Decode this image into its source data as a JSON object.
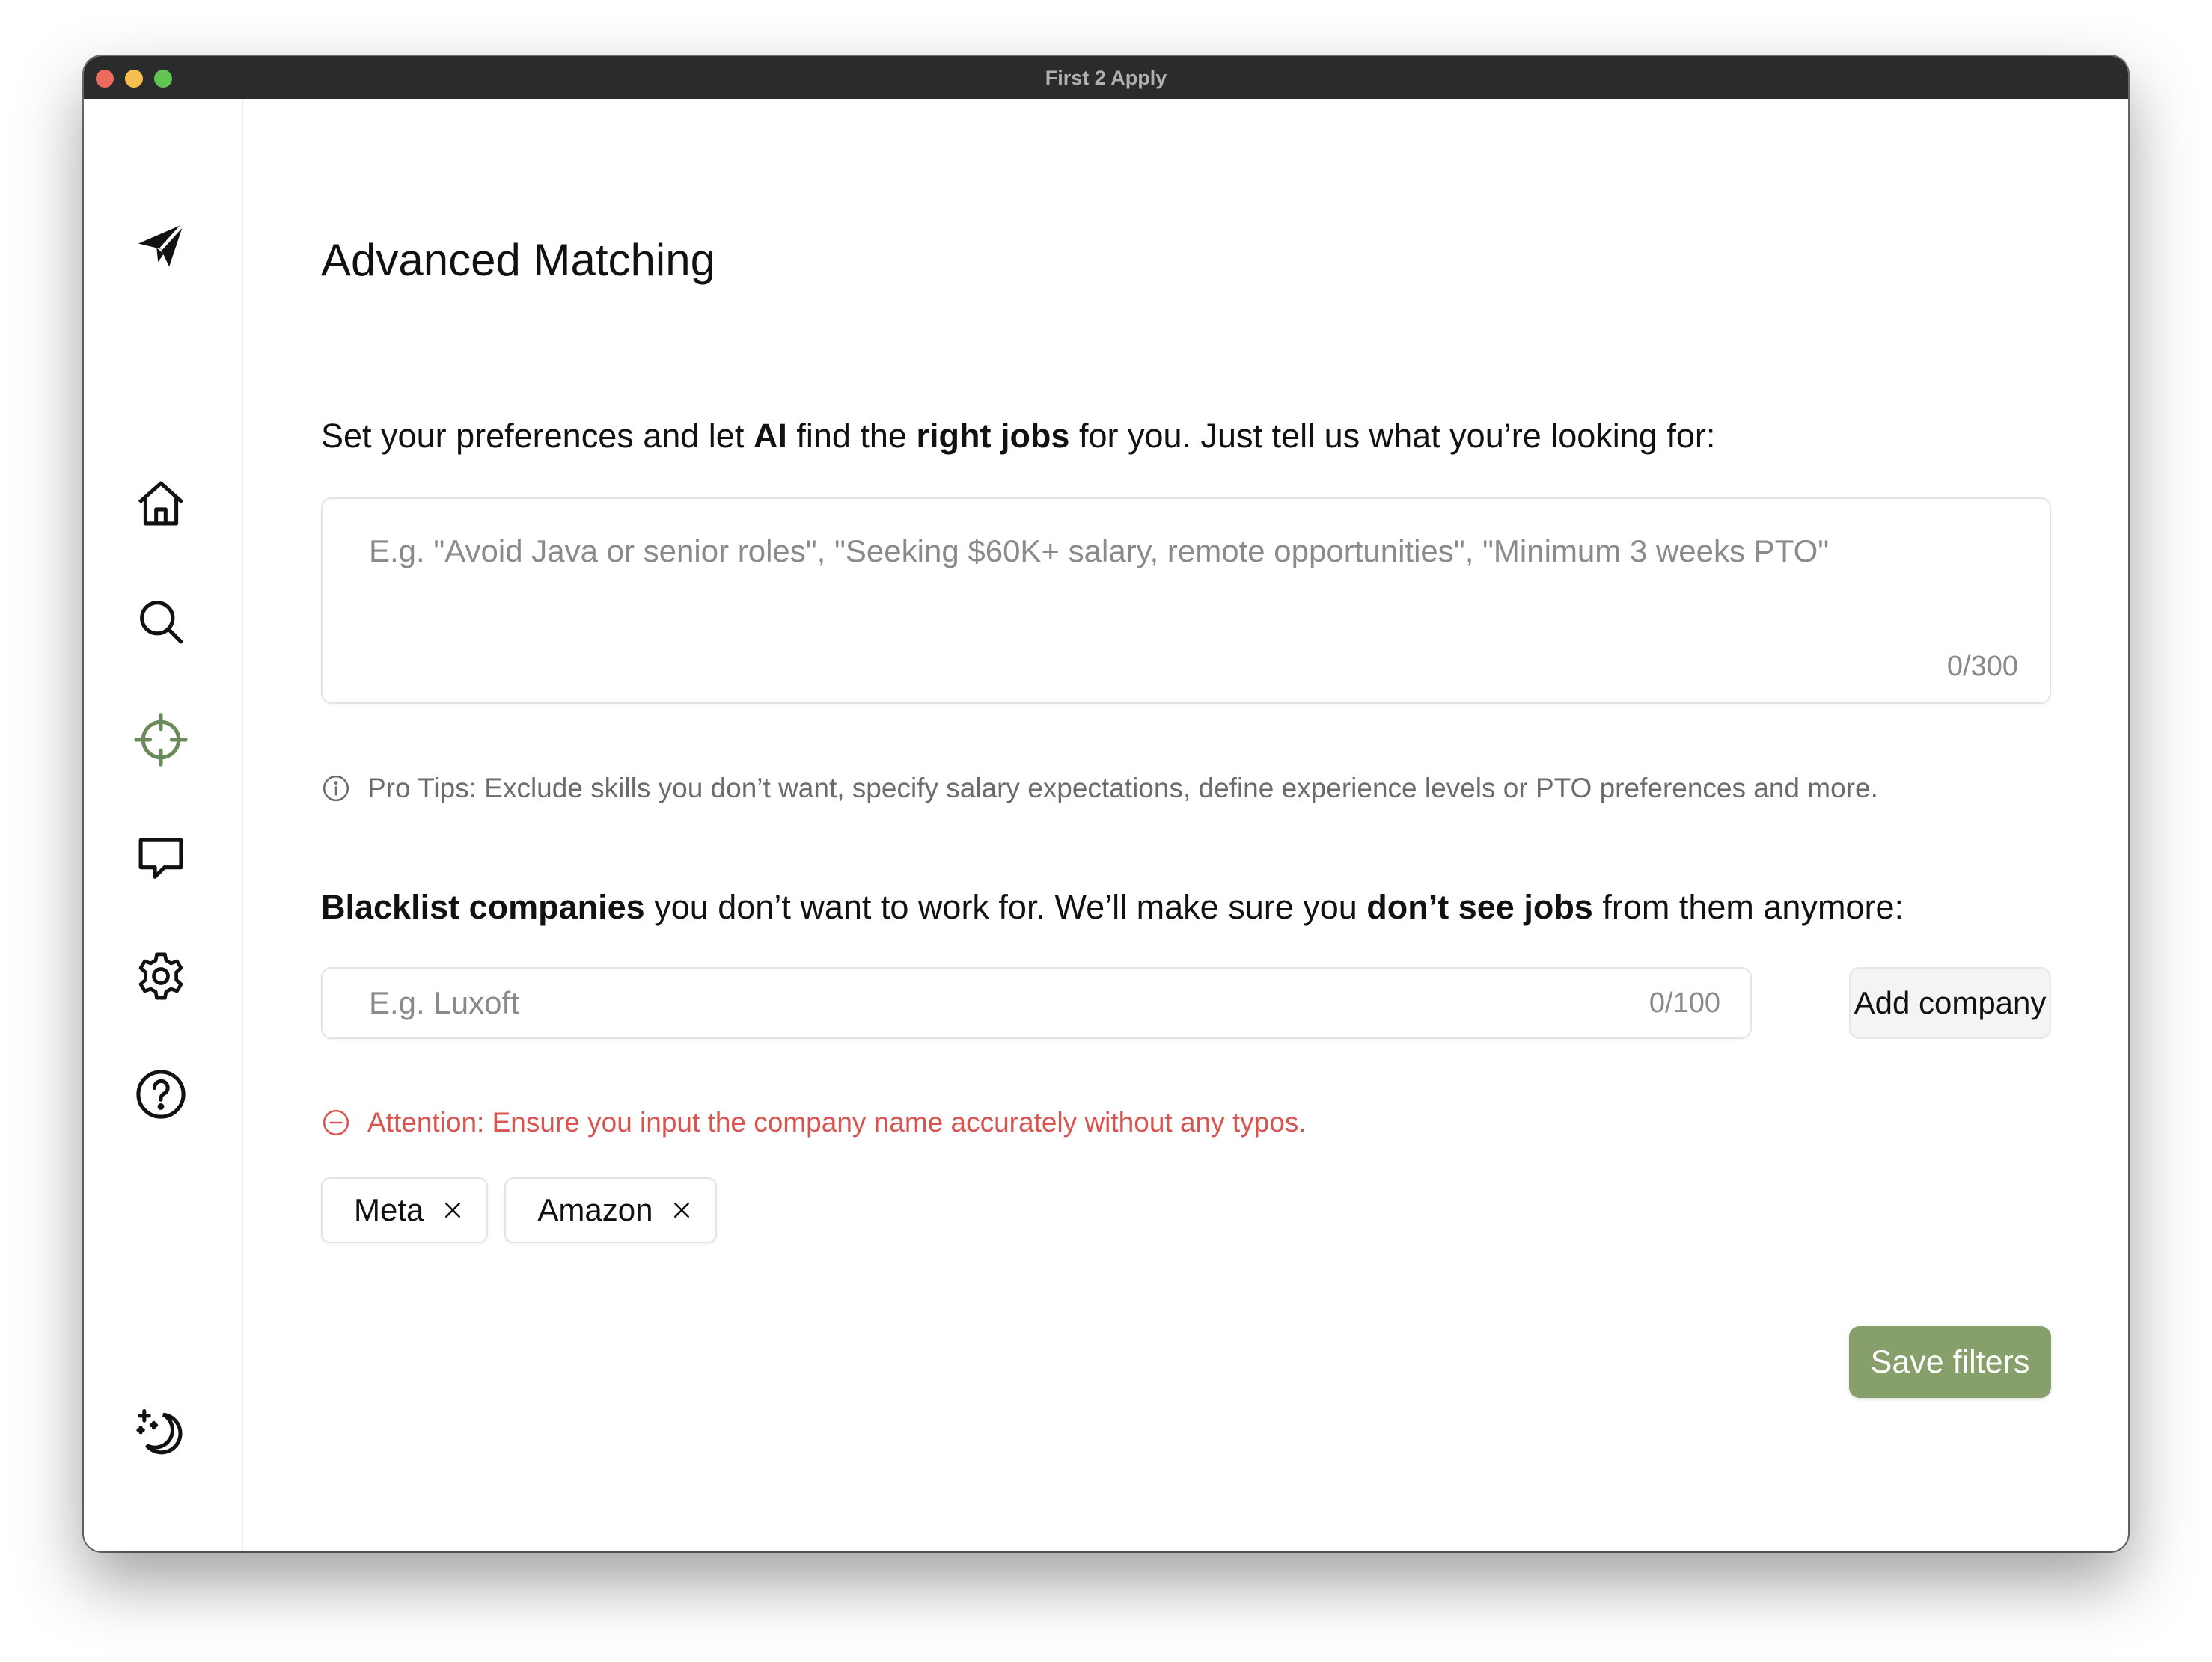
{
  "window": {
    "title": "First 2 Apply"
  },
  "sidebar": {
    "items": [
      {
        "icon": "paper-plane-icon",
        "label": ""
      },
      {
        "icon": "home-icon",
        "label": ""
      },
      {
        "icon": "search-icon",
        "label": ""
      },
      {
        "icon": "crosshair-icon",
        "label": "",
        "active": true
      },
      {
        "icon": "chat-bubble-icon",
        "label": ""
      },
      {
        "icon": "gear-icon",
        "label": ""
      },
      {
        "icon": "help-icon",
        "label": ""
      },
      {
        "icon": "moon-stars-icon",
        "label": ""
      }
    ],
    "active_color": "#6b8a5a"
  },
  "main": {
    "title": "Advanced Matching",
    "preferences": {
      "heading_parts": [
        "Set your preferences and let ",
        "AI",
        " find the ",
        "right jobs",
        " for you. Just tell us what you’re looking for:"
      ],
      "placeholder": "E.g. \"Avoid Java or senior roles\", \"Seeking $60K+ salary, remote opportunities\", \"Minimum 3 weeks PTO\"",
      "value": "",
      "counter": "0/300",
      "tip": "Pro Tips: Exclude skills you don’t want, specify salary expectations, define experience levels or PTO preferences and more."
    },
    "blacklist": {
      "heading_parts": [
        "Blacklist companies",
        " you don’t want to work for. We’ll make sure you ",
        "don’t see jobs",
        " from them anymore:"
      ],
      "placeholder": "E.g. Luxoft",
      "value": "",
      "counter": "0/100",
      "add_button": "Add company",
      "attention": "Attention: Ensure you input the company name accurately without any typos.",
      "companies": [
        "Meta",
        "Amazon"
      ]
    },
    "save_button": "Save filters"
  },
  "colors": {
    "accent": "#87a06b",
    "error": "#d9534f"
  }
}
